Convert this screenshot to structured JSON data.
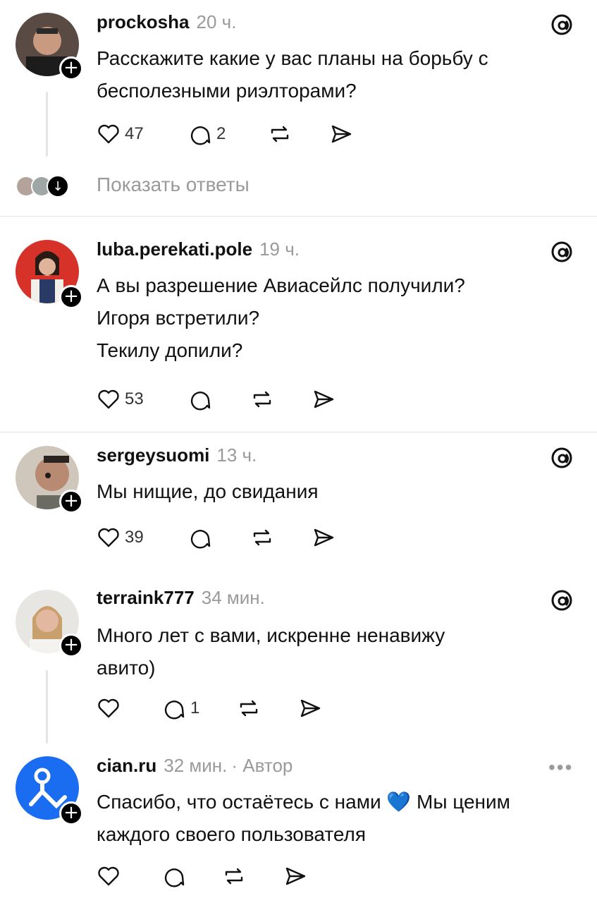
{
  "posts": [
    {
      "username": "prockosha",
      "time": "20 ч.",
      "lines": [
        "Расскажите какие у вас планы на борьбу с",
        "бесполезными риэлторами?"
      ],
      "likes": "47",
      "comments": "2",
      "avatar_icon": "person-photo"
    },
    {
      "username": "luba.perekati.pole",
      "time": "19 ч.",
      "lines": [
        "А вы разрешение Авиасейлс получили?",
        "Игоря встретили?",
        "Текилу допили?"
      ],
      "likes": "53",
      "comments": "",
      "avatar_icon": "person-photo"
    },
    {
      "username": "sergeysuomi",
      "time": "13 ч.",
      "lines": [
        "Мы нищие, до свидания"
      ],
      "likes": "39",
      "comments": "",
      "avatar_icon": "person-photo"
    },
    {
      "username": "terraink777",
      "time": "34 мин.",
      "lines": [
        "Много лет с вами, искренне ненавижу",
        "авито)"
      ],
      "likes": "",
      "comments": "1",
      "avatar_icon": "person-photo"
    },
    {
      "username": "cian.ru",
      "time": "32 мин.",
      "author_label": "· Автор",
      "line1_before": "Спасибо, что остаётесь с нами",
      "line1_emoji": "💙",
      "line1_after": "Мы ценим",
      "line2": "каждого своего пользователя",
      "likes": "",
      "comments": "",
      "avatar_icon": "cian-logo",
      "brand_color": "#1a6cf0"
    }
  ],
  "show_replies_label": "Показать ответы",
  "more_label": "•••",
  "plus_label": "+",
  "down_arrow": "↓",
  "icons": [
    "heart-icon",
    "comment-icon",
    "repost-icon",
    "share-icon",
    "threads-icon",
    "more-icon"
  ]
}
